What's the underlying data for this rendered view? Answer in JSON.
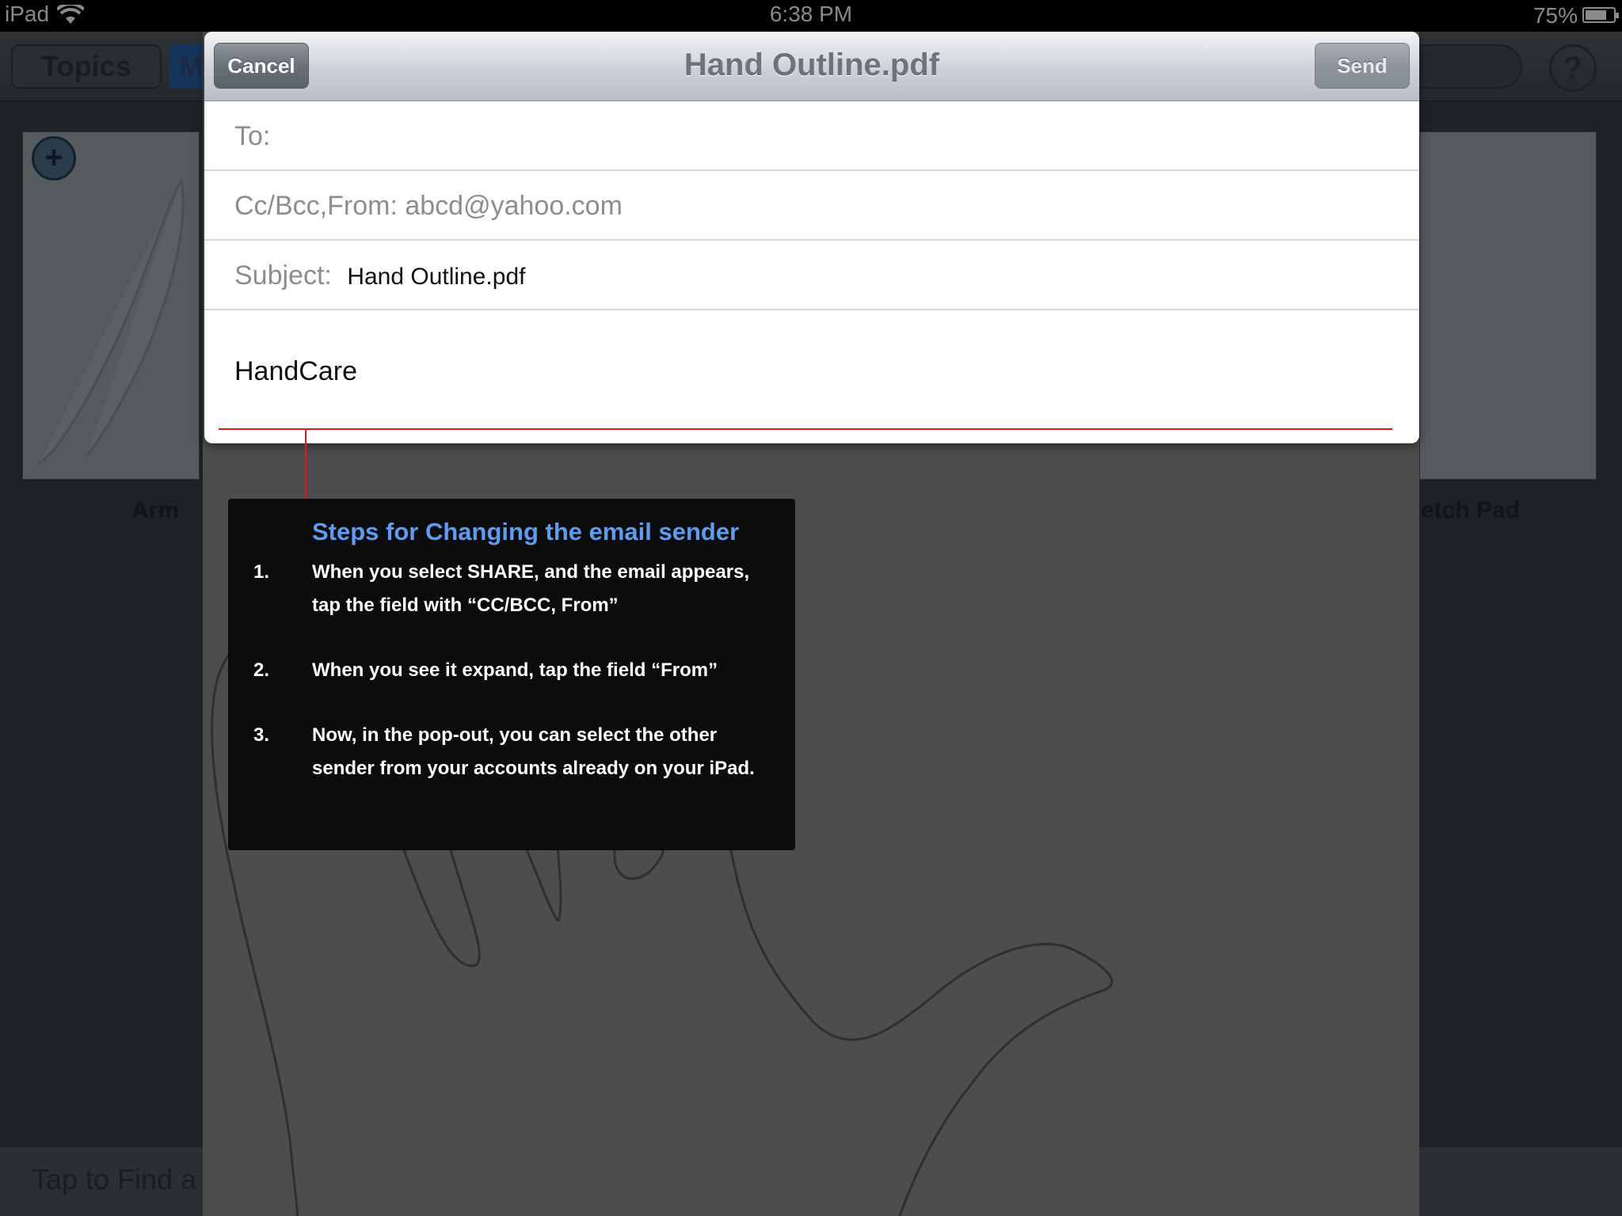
{
  "status_bar": {
    "device": "iPad",
    "time": "6:38 PM",
    "battery_pct": "75%",
    "battery_level": 0.75
  },
  "background_app": {
    "topics_label": "Topics",
    "mode_label": "M",
    "help_label": "?",
    "thumbnails": [
      {
        "label": "Arm"
      },
      {
        "label": "etch Pad"
      }
    ],
    "add_label": "+",
    "find_placeholder": "Tap to Find a"
  },
  "compose": {
    "title": "Hand Outline.pdf",
    "cancel_label": "Cancel",
    "send_label": "Send",
    "to_label": "To:",
    "ccbcc_label": "Cc/Bcc,From:",
    "ccbcc_value": "abcd@yahoo.com",
    "subject_label": "Subject:",
    "subject_value": "Hand Outline.pdf",
    "body": "HandCare"
  },
  "instructions": {
    "heading": "Steps for Changing the email sender",
    "steps": [
      {
        "num": "1.",
        "text": "When you select SHARE, and the email appears, tap the field with “CC/BCC, From”"
      },
      {
        "num": "2.",
        "text": "When you see it expand, tap the field “From”"
      },
      {
        "num": "3.",
        "text": "Now, in the pop-out, you can select the other sender from your accounts already on your iPad."
      }
    ],
    "heading_color": "#5f9cf0",
    "callout_color": "#d91c1c"
  }
}
